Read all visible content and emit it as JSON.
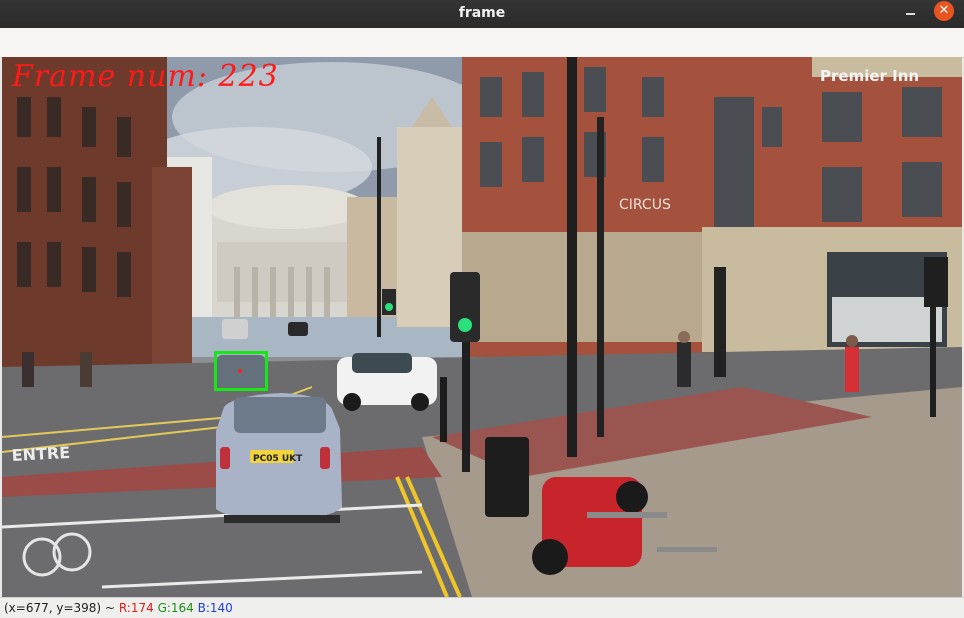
{
  "window": {
    "title": "frame",
    "minimize_icon": "minimize-icon",
    "close_icon": "close-icon",
    "close_glyph": "✕",
    "close_color": "#e95420"
  },
  "frame": {
    "overlay_text": "Frame num: 223",
    "overlay_color": "#ff1a1a",
    "detection_color": "#19e619",
    "scene_signs": {
      "premier_inn": "Premier Inn",
      "circus": "CIRCUS",
      "plate": "PC05 UKT",
      "road_text": "ENTRE"
    }
  },
  "statusbar": {
    "coords": "(x=677, y=398) ~",
    "r": "R:174",
    "g": "G:164",
    "b": "B:140"
  }
}
